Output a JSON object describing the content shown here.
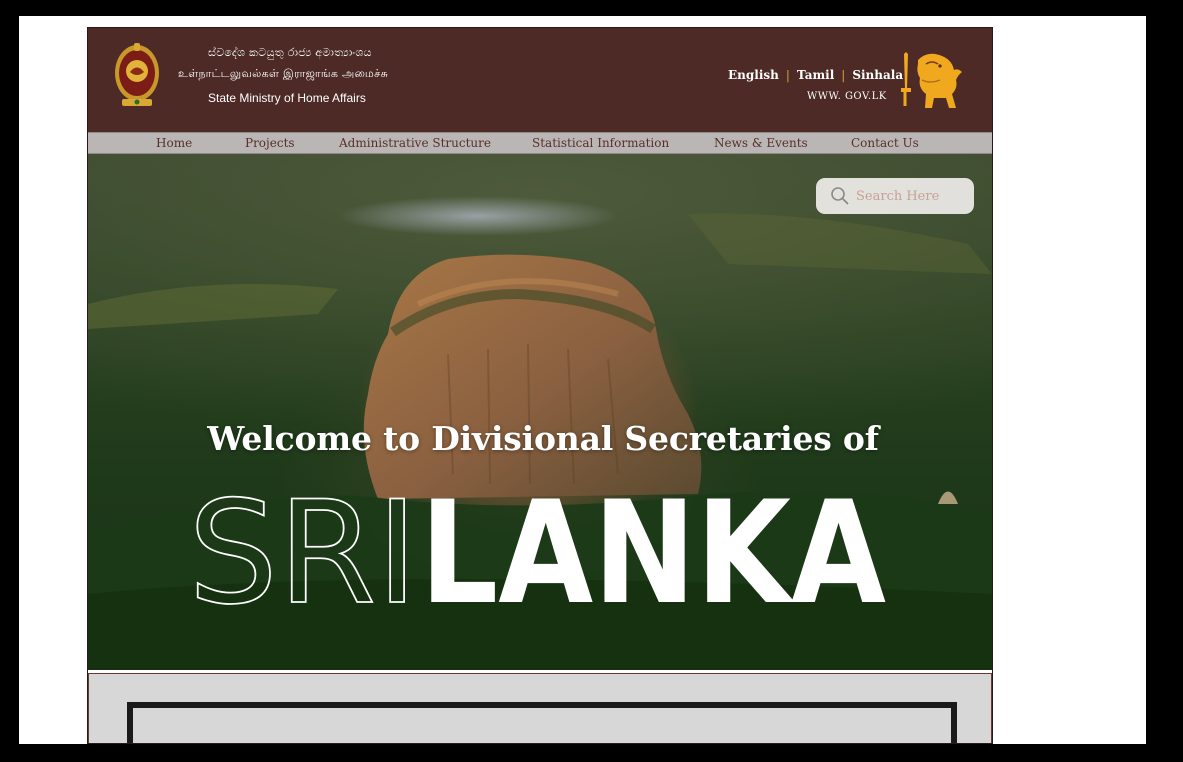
{
  "header": {
    "ministry_si": "ස්වදේශ කටයුතු රාජ්‍ය අමාත්‍යාංශය",
    "ministry_ta": "உள்நாட்டலுவல்கள் இராஜாங்க அமைச்சு",
    "ministry_en": "State Ministry of Home Affairs",
    "languages": [
      "English",
      "Tamil",
      "Sinhala"
    ],
    "gov_link": "WWW. GOV.LK",
    "emblem_icon": "sri-lanka-emblem-icon",
    "lion_icon": "lion-flag-icon"
  },
  "nav": {
    "items": [
      "Home",
      "Projects",
      "Administrative Structure",
      "Statistical Information",
      "News & Events",
      "Contact Us"
    ]
  },
  "hero": {
    "search_placeholder": "Search Here",
    "search_icon": "search-icon",
    "welcome": "Welcome to Divisional Secretaries of",
    "sri": "SRI",
    "lanka": "LANKA"
  },
  "colors": {
    "header_bg": "#4d2a26",
    "nav_bg": "#b9b6b5",
    "nav_text": "#5a2f28",
    "accent_gold": "#d4a93a"
  }
}
